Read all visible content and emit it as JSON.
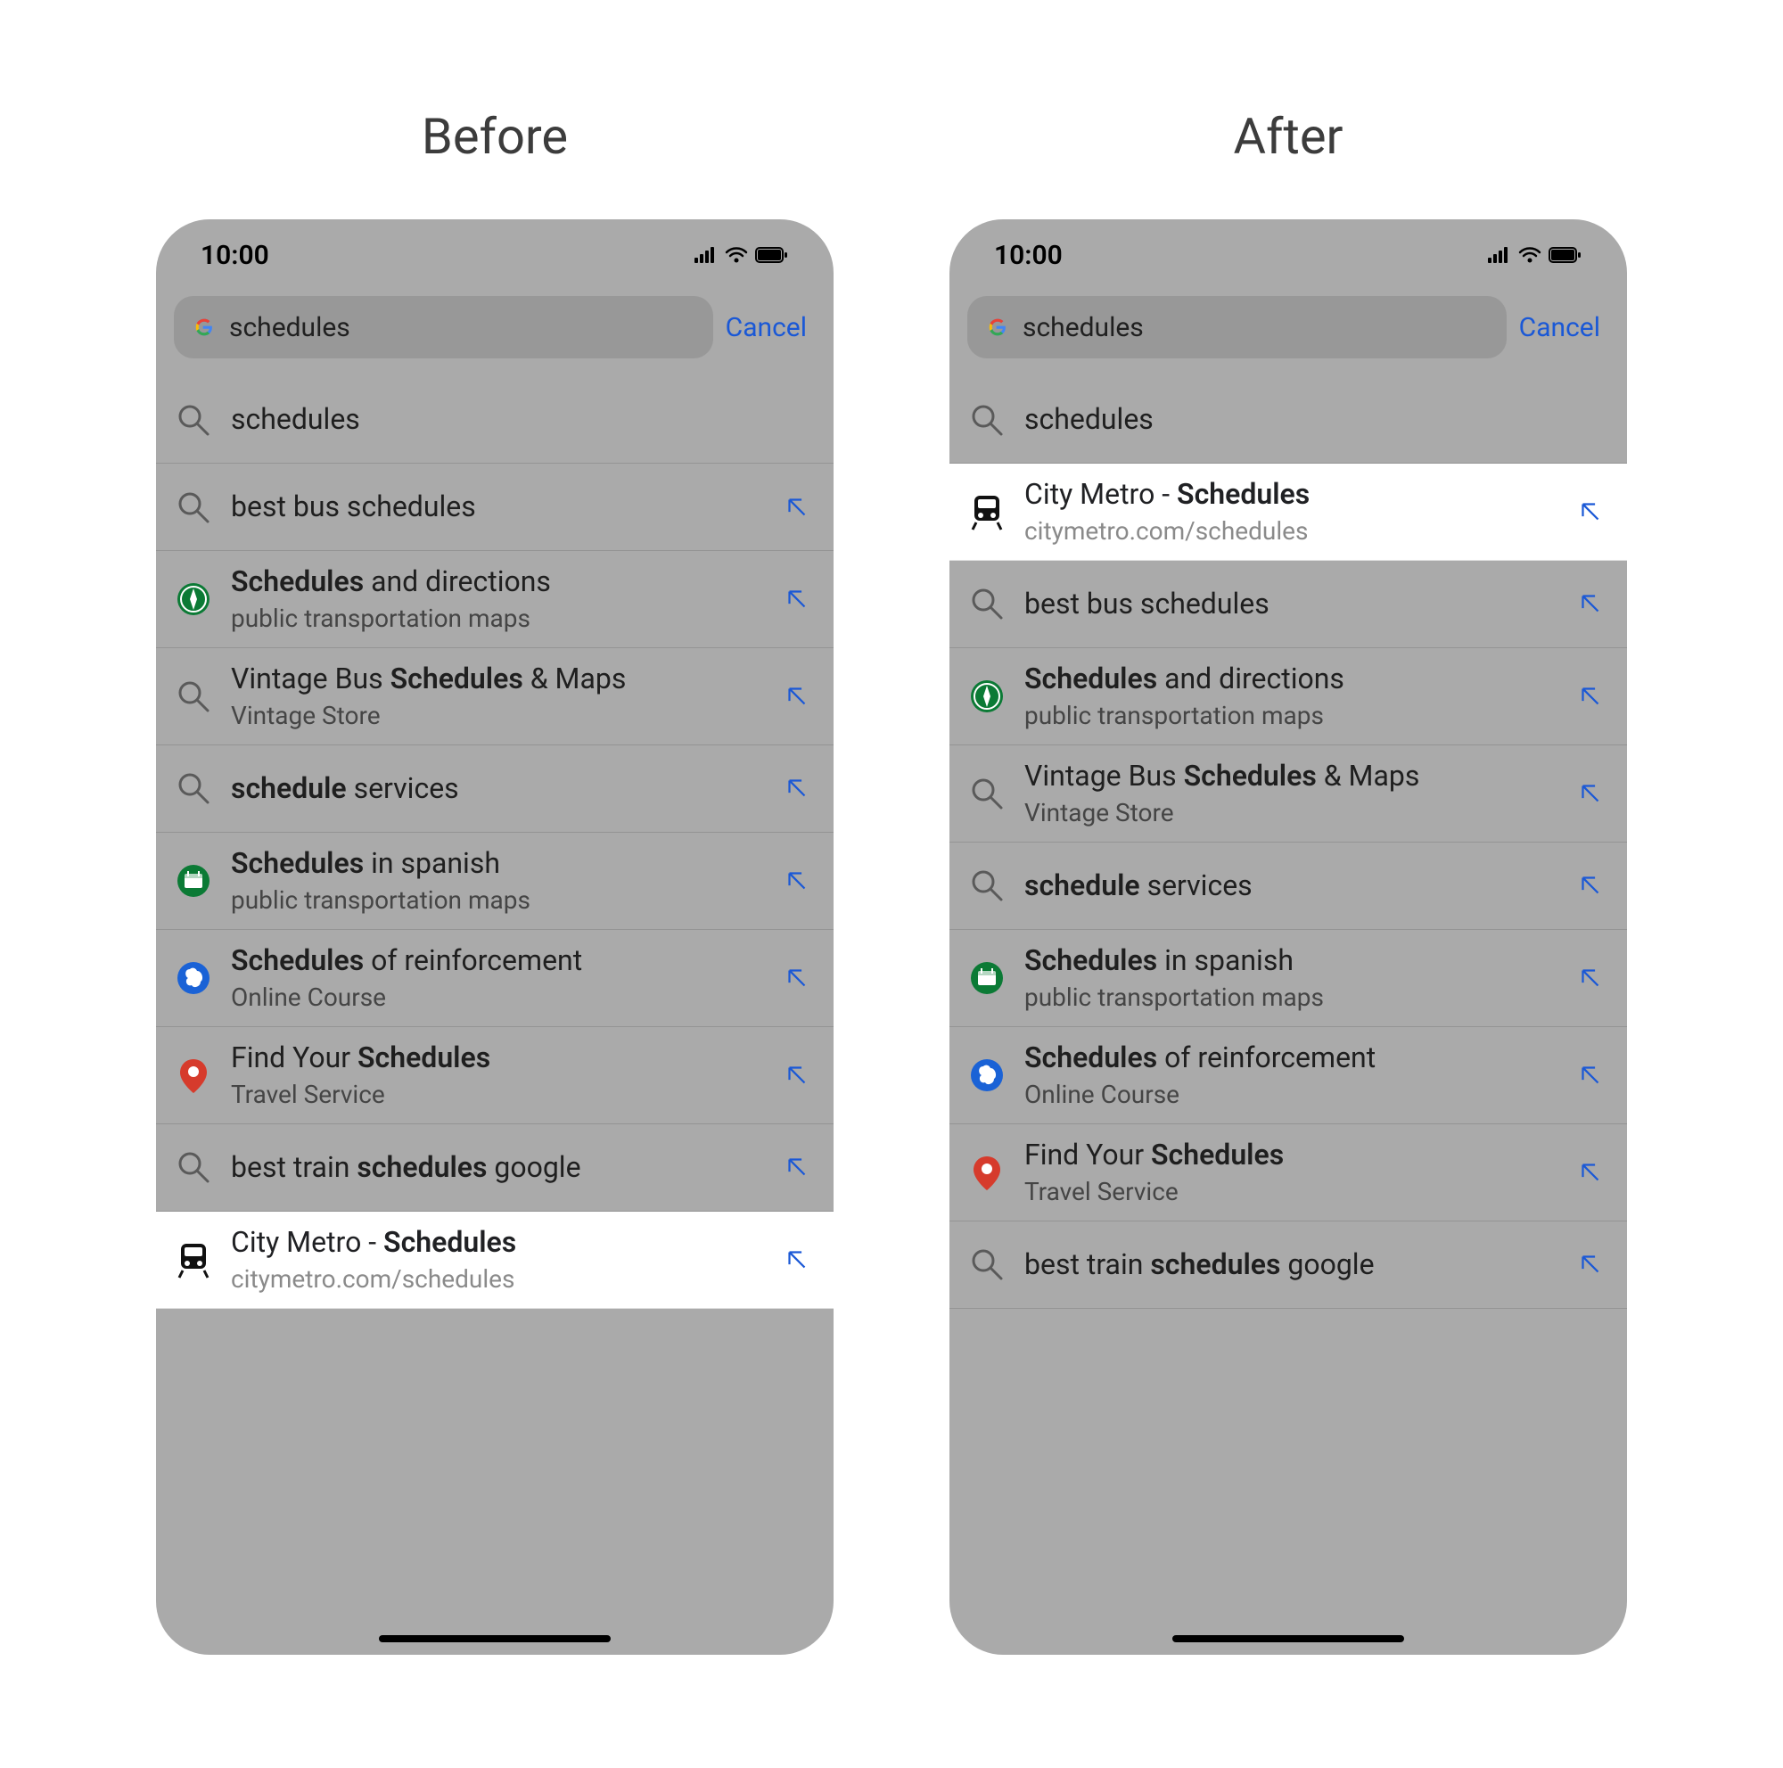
{
  "titles": {
    "before": "Before",
    "after": "After"
  },
  "status": {
    "time": "10:00"
  },
  "search": {
    "value": "schedules",
    "cancel": "Cancel"
  },
  "icons": {
    "search": "search-icon",
    "compass": "compass-icon",
    "calendar": "calendar-icon",
    "brain": "brain-icon",
    "pin": "pin-icon",
    "train": "train-icon"
  },
  "suggestions": {
    "before": [
      {
        "icon": "search",
        "title_pre": "",
        "title_bold": "",
        "title_post": "schedules",
        "sub": "",
        "arrow": false,
        "highlight": false
      },
      {
        "icon": "search",
        "title_pre": "best bus schedules",
        "title_bold": "",
        "title_post": "",
        "sub": "",
        "arrow": true,
        "highlight": false
      },
      {
        "icon": "compass",
        "title_pre": "",
        "title_bold": "Schedules",
        "title_post": " and directions",
        "sub": "public transportation maps",
        "arrow": true,
        "highlight": false
      },
      {
        "icon": "search",
        "title_pre": "Vintage Bus ",
        "title_bold": "Schedules",
        "title_post": " & Maps",
        "sub": "Vintage Store",
        "arrow": true,
        "highlight": false
      },
      {
        "icon": "search",
        "title_pre": "",
        "title_bold": "schedule",
        "title_post": " services",
        "sub": "",
        "arrow": true,
        "highlight": false
      },
      {
        "icon": "calendar",
        "title_pre": "",
        "title_bold": "Schedules",
        "title_post": " in spanish",
        "sub": "public transportation maps",
        "arrow": true,
        "highlight": false
      },
      {
        "icon": "brain",
        "title_pre": "",
        "title_bold": "Schedules",
        "title_post": " of reinforcement",
        "sub": "Online Course",
        "arrow": true,
        "highlight": false
      },
      {
        "icon": "pin",
        "title_pre": "Find Your ",
        "title_bold": "Schedules",
        "title_post": "",
        "sub": "Travel Service",
        "arrow": true,
        "highlight": false
      },
      {
        "icon": "search",
        "title_pre": "best train ",
        "title_bold": "schedules",
        "title_post": " google",
        "sub": "",
        "arrow": true,
        "highlight": false
      },
      {
        "icon": "train",
        "title_pre": "City Metro -  ",
        "title_bold": "Schedules",
        "title_post": "",
        "sub": "citymetro.com/schedules",
        "arrow": true,
        "highlight": true
      }
    ],
    "after": [
      {
        "icon": "search",
        "title_pre": "",
        "title_bold": "",
        "title_post": "schedules",
        "sub": "",
        "arrow": false,
        "highlight": false
      },
      {
        "icon": "train",
        "title_pre": "City Metro -  ",
        "title_bold": "Schedules",
        "title_post": "",
        "sub": "citymetro.com/schedules",
        "arrow": true,
        "highlight": true
      },
      {
        "icon": "search",
        "title_pre": "best bus schedules",
        "title_bold": "",
        "title_post": "",
        "sub": "",
        "arrow": true,
        "highlight": false
      },
      {
        "icon": "compass",
        "title_pre": "",
        "title_bold": "Schedules",
        "title_post": " and directions",
        "sub": "public transportation maps",
        "arrow": true,
        "highlight": false
      },
      {
        "icon": "search",
        "title_pre": "Vintage Bus ",
        "title_bold": "Schedules",
        "title_post": " & Maps",
        "sub": "Vintage Store",
        "arrow": true,
        "highlight": false
      },
      {
        "icon": "search",
        "title_pre": "",
        "title_bold": "schedule",
        "title_post": " services",
        "sub": "",
        "arrow": true,
        "highlight": false
      },
      {
        "icon": "calendar",
        "title_pre": "",
        "title_bold": "Schedules",
        "title_post": " in spanish",
        "sub": "public transportation maps",
        "arrow": true,
        "highlight": false
      },
      {
        "icon": "brain",
        "title_pre": "",
        "title_bold": "Schedules",
        "title_post": " of reinforcement",
        "sub": "Online Course",
        "arrow": true,
        "highlight": false
      },
      {
        "icon": "pin",
        "title_pre": "Find Your ",
        "title_bold": "Schedules",
        "title_post": "",
        "sub": "Travel Service",
        "arrow": true,
        "highlight": false
      },
      {
        "icon": "search",
        "title_pre": "best train ",
        "title_bold": "schedules",
        "title_post": " google",
        "sub": "",
        "arrow": true,
        "highlight": false
      }
    ]
  }
}
